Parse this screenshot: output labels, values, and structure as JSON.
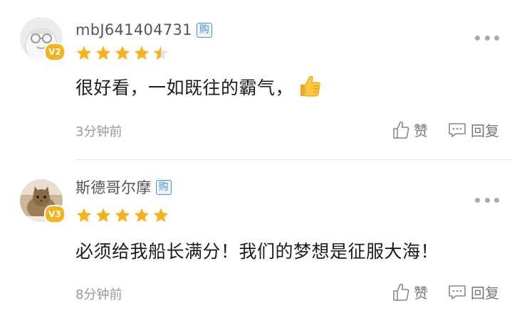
{
  "comments": [
    {
      "username": "mbJ641404731",
      "buy_badge": "购",
      "level": "V2",
      "rating": 4.5,
      "content": "很好看，一如既往的霸气，",
      "content_emoji": "thumbs-up-icon",
      "time": "3分钟前",
      "like_label": "赞",
      "reply_label": "回复"
    },
    {
      "username": "斯德哥尔摩",
      "buy_badge": "购",
      "level": "V3",
      "rating": 5,
      "content": "必须给我船长满分！我们的梦想是征服大海！",
      "time": "8分钟前",
      "like_label": "赞",
      "reply_label": "回复"
    }
  ],
  "colors": {
    "star": "#f7b21b",
    "badge_blue": "#4a90d9",
    "muted_text": "#999999"
  }
}
